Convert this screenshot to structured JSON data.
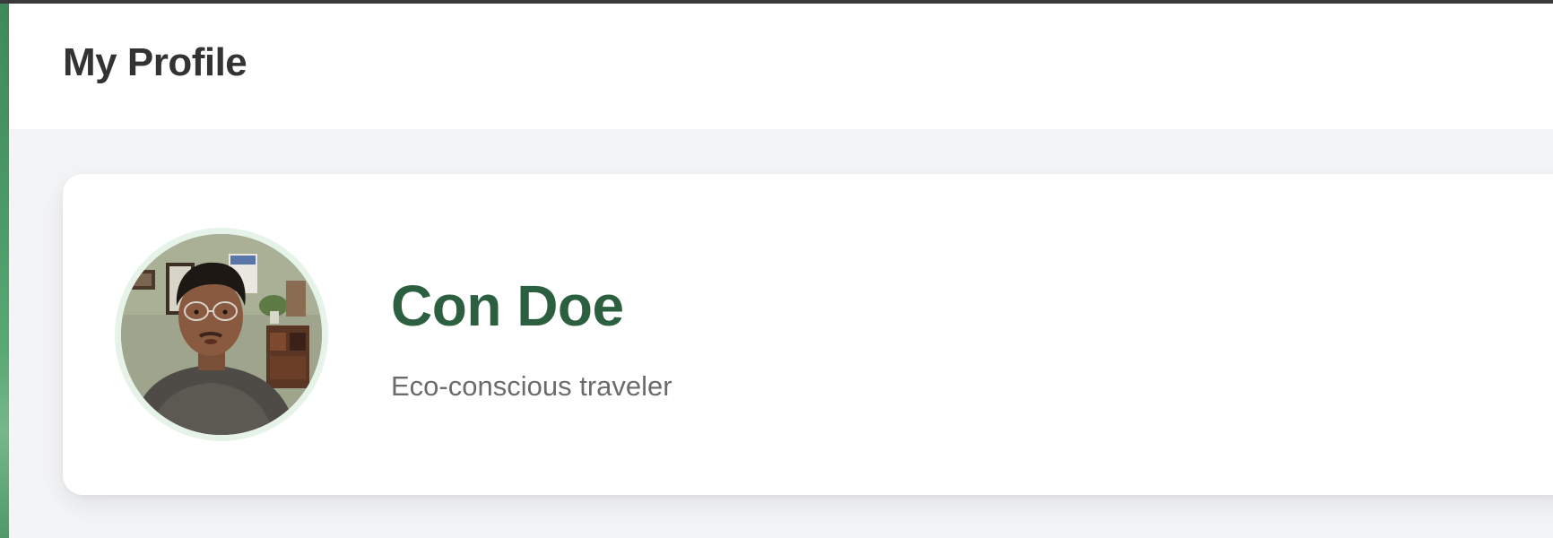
{
  "header": {
    "title": "My Profile"
  },
  "profile": {
    "name": "Con Doe",
    "tagline": "Eco-conscious traveler",
    "avatar_icon": "user-photo"
  },
  "colors": {
    "brand_green": "#2c5f3f",
    "avatar_ring": "#e6f3e9",
    "sidebar_green": "#4c9a67",
    "title_text": "#333333",
    "tagline_text": "#6b6b6b",
    "page_bg": "#f3f4f6"
  }
}
